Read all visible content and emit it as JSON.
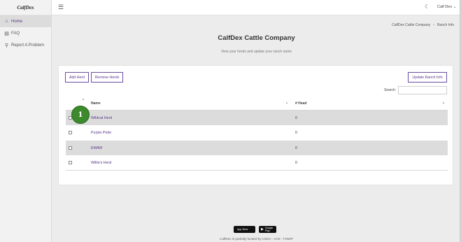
{
  "sidebar": {
    "brand": "CalfDex",
    "items": [
      {
        "icon": "⌂",
        "label": "Home"
      },
      {
        "icon": "▤",
        "label": "FAQ"
      },
      {
        "icon": "⚲",
        "label": "Report A Problem"
      }
    ]
  },
  "topbar": {
    "user_label": "Calf Dex ⌄"
  },
  "breadcrumb": {
    "company": "CalfDex Cattle Company",
    "separator": "›",
    "current": "Ranch Info"
  },
  "header": {
    "title": "CalfDex Cattle Company",
    "subtitle": "View your herds and update your ranch name"
  },
  "toolbar": {
    "add_label": "Add Herd",
    "remove_label": "Remove Herds",
    "update_label": "Update Ranch Info"
  },
  "search": {
    "label": "Search:",
    "value": ""
  },
  "table": {
    "col_name": "Name",
    "col_heads": "# Head",
    "rows": [
      {
        "name": "Wildcat Herd",
        "heads": "0"
      },
      {
        "name": "Purple Pride",
        "heads": "0"
      },
      {
        "name": "EMAW",
        "heads": "0"
      },
      {
        "name": "Willie's Herd",
        "heads": "0"
      }
    ]
  },
  "marker": {
    "label": "1",
    "color": "#3c8a2b"
  },
  "footer": {
    "apple_badge": "App Store",
    "google_badge": "Google Play",
    "text": "CalfDex is partially funded by USDA - AHS - FSMIP"
  },
  "colors": {
    "accent": "#5b3a8a",
    "row_alt": "#dcdcdc"
  }
}
